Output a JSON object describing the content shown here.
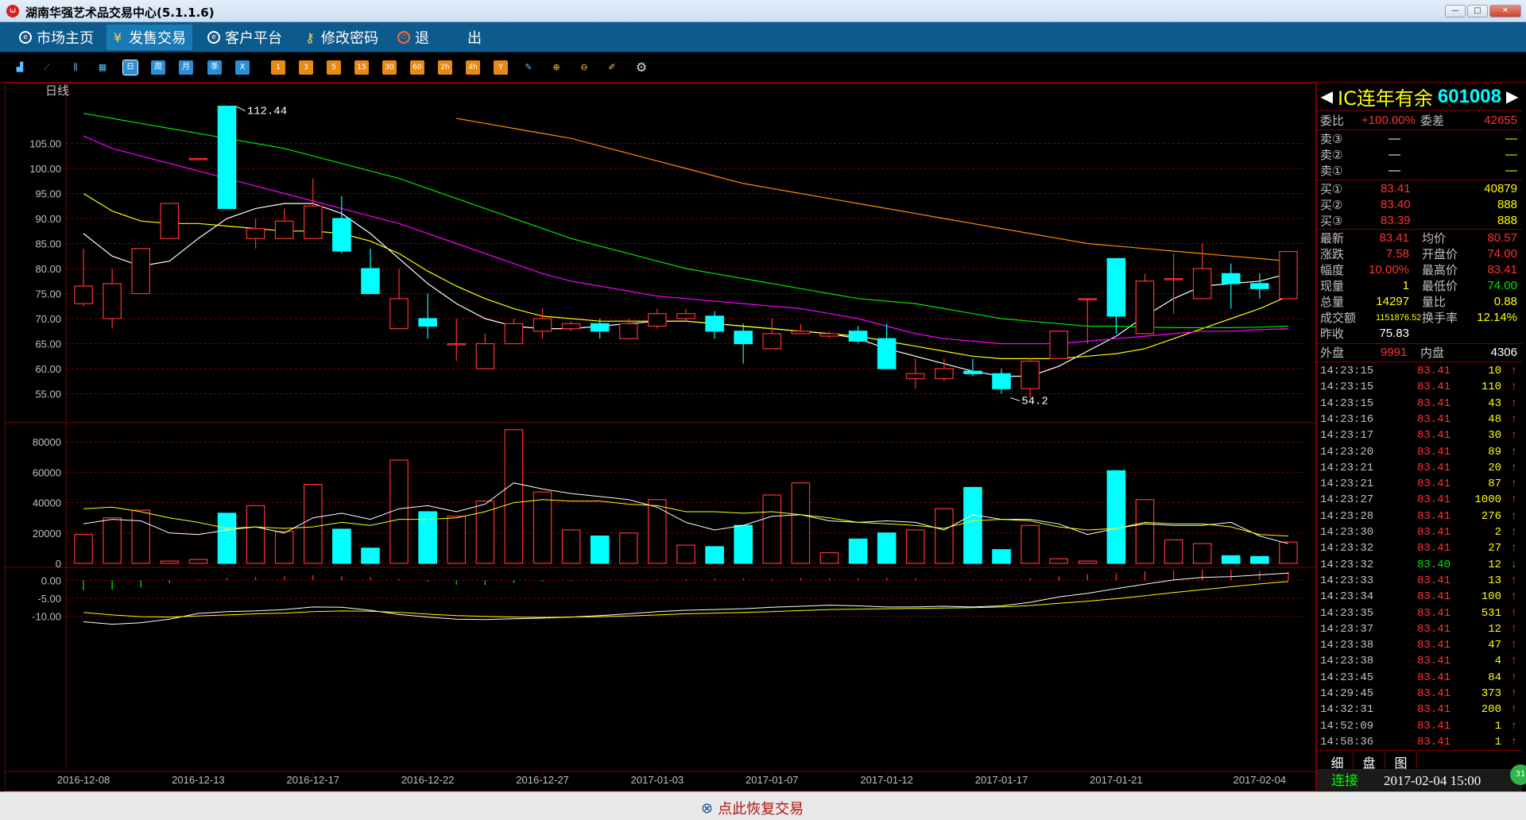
{
  "window": {
    "title": "湖南华强艺术品交易中心(5.1.1.6)",
    "logo_glyph": "ω",
    "btn_min": "—",
    "btn_max": "□",
    "btn_close": "✕"
  },
  "menu": [
    {
      "label": "市场主页",
      "icon": "globe-icon"
    },
    {
      "label": "发售交易",
      "icon": "yen-icon"
    },
    {
      "label": "客户平台",
      "icon": "globe-icon"
    },
    {
      "label": "修改密码",
      "icon": "key-icon"
    },
    {
      "label": "退",
      "icon": "power-icon"
    },
    {
      "label": "出",
      "icon": ""
    }
  ],
  "toolbar": {
    "period_buttons": [
      "日",
      "周",
      "月",
      "季",
      "X"
    ],
    "minute_buttons": [
      "1",
      "3",
      "5",
      "15",
      "30",
      "60",
      "2h",
      "4h",
      "Y"
    ],
    "selected": "日"
  },
  "chart_data": {
    "type": "candlestick",
    "period_label": "日线",
    "x_tick_labels": [
      "2016-12-08",
      "2016-12-13",
      "2016-12-17",
      "2016-12-22",
      "2016-12-27",
      "2017-01-03",
      "2017-01-07",
      "2017-01-12",
      "2017-01-17",
      "2017-01-21",
      "2017-02-04"
    ],
    "y_ticks_price": [
      "105.00",
      "100.00",
      "95.00",
      "90.00",
      "85.00",
      "80.00",
      "75.00",
      "70.00",
      "65.00",
      "60.00",
      "55.00"
    ],
    "y_ticks_volume": [
      "80000",
      "60000",
      "40000",
      "20000",
      "0"
    ],
    "y_ticks_macd": [
      "0.00",
      "-5.00",
      "-10.00"
    ],
    "annotations": {
      "high_label": "112.44",
      "low_label": "54.2"
    },
    "price_ylim": [
      50.0,
      113.5
    ],
    "volume_ylim": [
      0,
      90000
    ],
    "macd_ylim": [
      -12.5,
      2.5
    ],
    "candles": [
      {
        "o": 73,
        "h": 84,
        "l": 72.5,
        "c": 76.5
      },
      {
        "o": 70,
        "h": 80,
        "l": 68,
        "c": 77
      },
      {
        "o": 75,
        "h": 84,
        "l": 75,
        "c": 84
      },
      {
        "o": 86,
        "h": 92,
        "l": 86,
        "c": 93
      },
      {
        "o": 102,
        "h": 102,
        "l": 102,
        "c": 102
      },
      {
        "o": 112.44,
        "h": 112.44,
        "l": 92,
        "c": 92
      },
      {
        "o": 86,
        "h": 90,
        "l": 84,
        "c": 88
      },
      {
        "o": 86,
        "h": 92,
        "l": 86,
        "c": 89.5
      },
      {
        "o": 86,
        "h": 98,
        "l": 86,
        "c": 92.5
      },
      {
        "o": 90,
        "h": 94.5,
        "l": 83,
        "c": 83.5
      },
      {
        "o": 80,
        "h": 84,
        "l": 75,
        "c": 75
      },
      {
        "o": 68,
        "h": 80,
        "l": 68,
        "c": 74
      },
      {
        "o": 70,
        "h": 75,
        "l": 66,
        "c": 68.5
      },
      {
        "o": 65,
        "h": 70,
        "l": 61.5,
        "c": 65
      },
      {
        "o": 60,
        "h": 67,
        "l": 60,
        "c": 65
      },
      {
        "o": 65,
        "h": 70,
        "l": 65,
        "c": 69
      },
      {
        "o": 67.5,
        "h": 72,
        "l": 66,
        "c": 70
      },
      {
        "o": 68,
        "h": 69.5,
        "l": 67.5,
        "c": 69
      },
      {
        "o": 69,
        "h": 70,
        "l": 66,
        "c": 67.5
      },
      {
        "o": 66,
        "h": 70,
        "l": 66,
        "c": 69
      },
      {
        "o": 68.5,
        "h": 72,
        "l": 68,
        "c": 71
      },
      {
        "o": 70,
        "h": 72,
        "l": 69.5,
        "c": 71
      },
      {
        "o": 70.5,
        "h": 71.5,
        "l": 66,
        "c": 67.5
      },
      {
        "o": 67.5,
        "h": 69,
        "l": 61,
        "c": 65
      },
      {
        "o": 64,
        "h": 70,
        "l": 64,
        "c": 67
      },
      {
        "o": 67,
        "h": 69,
        "l": 67,
        "c": 67.5
      },
      {
        "o": 66.5,
        "h": 67.5,
        "l": 66,
        "c": 67
      },
      {
        "o": 67.5,
        "h": 68.5,
        "l": 65,
        "c": 65.5
      },
      {
        "o": 66,
        "h": 69,
        "l": 60,
        "c": 60
      },
      {
        "o": 58,
        "h": 62,
        "l": 56,
        "c": 59
      },
      {
        "o": 58,
        "h": 62,
        "l": 57.5,
        "c": 60
      },
      {
        "o": 59.5,
        "h": 62,
        "l": 58.5,
        "c": 59
      },
      {
        "o": 59,
        "h": 60,
        "l": 55,
        "c": 56
      },
      {
        "o": 56,
        "h": 62,
        "l": 54.2,
        "c": 61.5
      },
      {
        "o": 62,
        "h": 67.5,
        "l": 62,
        "c": 67.5
      },
      {
        "o": 74,
        "h": 74,
        "l": 65,
        "c": 74
      },
      {
        "o": 82,
        "h": 82,
        "l": 67,
        "c": 70.5
      },
      {
        "o": 67,
        "h": 79,
        "l": 67,
        "c": 77.5
      },
      {
        "o": 78,
        "h": 83,
        "l": 71,
        "c": 78
      },
      {
        "o": 74,
        "h": 85,
        "l": 74,
        "c": 80
      },
      {
        "o": 79,
        "h": 81,
        "l": 72,
        "c": 77
      },
      {
        "o": 77,
        "h": 79,
        "l": 74,
        "c": 76
      },
      {
        "o": 74,
        "h": 83.41,
        "l": 74,
        "c": 83.41
      }
    ],
    "ma_series": [
      {
        "color": "#ffffff",
        "values": [
          87.0,
          82.5,
          80.5,
          81.5,
          86.0,
          90.0,
          92.0,
          93.0,
          93.0,
          91.0,
          87.0,
          82.0,
          77.0,
          73.0,
          70.0,
          68.5,
          68.0,
          68.0,
          68.5,
          69.0,
          69.5,
          69.5,
          69.0,
          68.5,
          68.0,
          67.5,
          67.0,
          66.0,
          64.0,
          62.5,
          61.0,
          59.5,
          58.5,
          58.5,
          60.5,
          63.5,
          66.5,
          70.5,
          74.0,
          76.5,
          77.0,
          77.5,
          79.0
        ]
      },
      {
        "color": "#ffff00",
        "values": [
          95.0,
          91.5,
          89.5,
          89.0,
          89.0,
          88.5,
          88.0,
          87.5,
          87.5,
          87.0,
          85.5,
          83.0,
          79.5,
          76.5,
          74.0,
          72.0,
          70.5,
          70.0,
          69.5,
          69.5,
          69.5,
          69.5,
          69.0,
          68.5,
          68.0,
          67.5,
          67.0,
          66.5,
          65.5,
          64.5,
          63.5,
          62.5,
          62.0,
          62.0,
          62.0,
          62.5,
          63.0,
          64.0,
          66.0,
          68.0,
          70.0,
          72.0,
          74.5
        ]
      },
      {
        "color": "#ff00ff",
        "values": [
          106.5,
          104.0,
          102.5,
          101.0,
          99.5,
          98.0,
          96.5,
          95.0,
          93.5,
          92.0,
          90.5,
          89.0,
          87.0,
          85.0,
          83.0,
          81.0,
          79.0,
          77.5,
          76.5,
          75.5,
          74.5,
          74.0,
          73.5,
          73.0,
          72.5,
          72.0,
          71.0,
          70.0,
          68.5,
          67.0,
          66.0,
          65.5,
          65.0,
          65.0,
          65.0,
          65.5,
          66.0,
          66.5,
          67.0,
          67.5,
          67.5,
          67.8,
          68.0
        ]
      },
      {
        "color": "#00e600",
        "values": [
          111.0,
          110.0,
          109.0,
          108.0,
          107.0,
          106.0,
          105.0,
          104.0,
          102.5,
          101.0,
          99.5,
          98.0,
          96.0,
          94.0,
          92.0,
          90.0,
          88.0,
          86.0,
          84.5,
          83.0,
          81.5,
          80.0,
          79.0,
          78.0,
          77.0,
          76.0,
          75.0,
          74.0,
          73.5,
          73.0,
          72.0,
          71.0,
          70.0,
          69.5,
          69.0,
          68.5,
          68.5,
          68.3,
          68.2,
          68.2,
          68.2,
          68.3,
          68.5
        ]
      },
      {
        "color": "#ff8c00",
        "start_index": 13,
        "values": [
          110.0,
          109.0,
          108.0,
          107.0,
          106.0,
          104.5,
          103.0,
          101.5,
          100.0,
          98.5,
          97.0,
          96.0,
          95.0,
          94.0,
          93.0,
          92.0,
          91.0,
          90.0,
          89.0,
          88.0,
          87.0,
          86.0,
          85.0,
          84.5,
          84.0,
          83.5,
          83.0,
          82.5,
          82.0,
          81.5
        ]
      }
    ],
    "volume": [
      19000,
      30000,
      35000,
      1500,
      2500,
      33000,
      38000,
      21000,
      52000,
      22500,
      10000,
      68000,
      34000,
      31000,
      41000,
      88000,
      47000,
      22000,
      18000,
      20000,
      42000,
      12000,
      11000,
      25000,
      45000,
      53000,
      7000,
      16000,
      20000,
      22000,
      36000,
      50000,
      9000,
      25000,
      3000,
      1500,
      61000,
      42000,
      15500,
      13000,
      5000,
      4500,
      14000
    ],
    "volume_ma": [
      {
        "color": "#ffffff",
        "values": [
          26000,
          29000,
          28000,
          20000,
          19000,
          22000,
          24000,
          20000,
          30000,
          33000,
          29000,
          36000,
          38000,
          34000,
          39000,
          53000,
          49000,
          46000,
          44000,
          42000,
          37000,
          27000,
          22000,
          25000,
          31000,
          32000,
          28000,
          27000,
          28000,
          27000,
          22000,
          32000,
          29000,
          29000,
          26000,
          19000,
          23000,
          26000,
          25000,
          25000,
          27000,
          18000,
          13000
        ]
      },
      {
        "color": "#ffff00",
        "values": [
          36000,
          37000,
          34000,
          30000,
          27000,
          23000,
          24000,
          23000,
          24000,
          27000,
          25000,
          29000,
          29000,
          30000,
          34000,
          40000,
          42000,
          41000,
          41000,
          39000,
          38000,
          34000,
          34000,
          33000,
          34000,
          32000,
          30000,
          27000,
          26000,
          25000,
          23000,
          28000,
          29000,
          28000,
          24000,
          22000,
          23000,
          27000,
          26000,
          26000,
          24000,
          19000,
          18000
        ]
      }
    ],
    "macd_bars": [
      -2.8,
      -2.6,
      -2.0,
      -0.8,
      0.2,
      0.6,
      0.9,
      1.1,
      1.4,
      1.2,
      0.9,
      0.4,
      -0.4,
      -1.2,
      -1.3,
      -0.8,
      -0.4,
      -0.2,
      -0.1,
      0.1,
      0.2,
      0.4,
      0.5,
      0.5,
      0.4,
      0.6,
      0.5,
      0.6,
      0.7,
      0.5,
      0.2,
      0.1,
      0.3,
      0.6,
      1.1,
      1.7,
      2.0,
      2.5,
      2.7,
      3.0,
      2.9,
      2.6,
      2.4
    ],
    "macd_diff": [
      -11.5,
      -12.2,
      -11.8,
      -10.8,
      -9.2,
      -8.7,
      -8.5,
      -8.1,
      -7.4,
      -7.5,
      -8.3,
      -9.5,
      -10.2,
      -10.8,
      -10.9,
      -10.7,
      -10.5,
      -10.2,
      -9.8,
      -9.3,
      -8.7,
      -8.3,
      -8.1,
      -7.9,
      -7.5,
      -7.2,
      -6.9,
      -7.1,
      -7.4,
      -7.4,
      -7.2,
      -7.4,
      -7.1,
      -6.1,
      -4.6,
      -3.6,
      -2.3,
      -1.1,
      0.1,
      0.8,
      1.0,
      1.5,
      2.0
    ],
    "macd_dea": [
      -8.9,
      -9.6,
      -10.1,
      -10.2,
      -9.9,
      -9.6,
      -9.3,
      -9.1,
      -8.7,
      -8.5,
      -8.6,
      -8.9,
      -9.4,
      -9.8,
      -10.0,
      -10.2,
      -10.3,
      -10.2,
      -10.1,
      -9.9,
      -9.6,
      -9.3,
      -9.1,
      -8.9,
      -8.7,
      -8.4,
      -8.1,
      -8.0,
      -7.9,
      -7.8,
      -7.7,
      -7.6,
      -7.4,
      -7.0,
      -6.4,
      -5.8,
      -5.1,
      -4.3,
      -3.4,
      -2.6,
      -1.8,
      -1.0,
      -0.3
    ]
  },
  "quote": {
    "name": "IC连年有余",
    "code": "601008",
    "weibi_label": "委比",
    "weibi_value": "+100.00%",
    "weicha_label": "委差",
    "weicha_value": "42655",
    "asks": [
      {
        "label": "卖③",
        "price": "—",
        "vol": "—"
      },
      {
        "label": "卖②",
        "price": "—",
        "vol": "—"
      },
      {
        "label": "卖①",
        "price": "—",
        "vol": "—"
      }
    ],
    "bids": [
      {
        "label": "买①",
        "price": "83.41",
        "vol": "40879"
      },
      {
        "label": "买②",
        "price": "83.40",
        "vol": "888"
      },
      {
        "label": "买③",
        "price": "83.39",
        "vol": "888"
      }
    ],
    "stats": [
      {
        "l1": "最新",
        "v1": "83.41",
        "l2": "均价",
        "v2": "80.57"
      },
      {
        "l1": "涨跌",
        "v1": "7.58",
        "l2": "开盘价",
        "v2": "74.00"
      },
      {
        "l1": "幅度",
        "v1": "10.00%",
        "l2": "最高价",
        "v2": "83.41"
      },
      {
        "l1": "现量",
        "v1": "1",
        "l2": "最低价",
        "v2": "74.00"
      },
      {
        "l1": "总量",
        "v1": "14297",
        "l2": "量比",
        "v2": "0.88"
      },
      {
        "l1": "成交额",
        "v1": "1151876.52",
        "l2": "换手率",
        "v2": "12.14%"
      },
      {
        "l1": "昨收",
        "v1": "75.83",
        "l2": "",
        "v2": ""
      }
    ],
    "outer_label": "外盘",
    "outer_value": "9991",
    "inner_label": "内盘",
    "inner_value": "4306",
    "ticks": [
      {
        "t": "14:23:15",
        "p": "83.41",
        "v": "10",
        "d": "↑"
      },
      {
        "t": "14:23:15",
        "p": "83.41",
        "v": "110",
        "d": "↑"
      },
      {
        "t": "14:23:15",
        "p": "83.41",
        "v": "43",
        "d": "↑"
      },
      {
        "t": "14:23:16",
        "p": "83.41",
        "v": "48",
        "d": "↑"
      },
      {
        "t": "14:23:17",
        "p": "83.41",
        "v": "30",
        "d": "↑"
      },
      {
        "t": "14:23:20",
        "p": "83.41",
        "v": "89",
        "d": "↑"
      },
      {
        "t": "14:23:21",
        "p": "83.41",
        "v": "20",
        "d": "↑"
      },
      {
        "t": "14:23:21",
        "p": "83.41",
        "v": "87",
        "d": "↑"
      },
      {
        "t": "14:23:27",
        "p": "83.41",
        "v": "1000",
        "d": "↑"
      },
      {
        "t": "14:23:28",
        "p": "83.41",
        "v": "276",
        "d": "↑"
      },
      {
        "t": "14:23:30",
        "p": "83.41",
        "v": "2",
        "d": "↑"
      },
      {
        "t": "14:23:32",
        "p": "83.41",
        "v": "27",
        "d": "↑"
      },
      {
        "t": "14:23:32",
        "p": "83.40",
        "v": "12",
        "d": "↓"
      },
      {
        "t": "14:23:33",
        "p": "83.41",
        "v": "13",
        "d": "↑"
      },
      {
        "t": "14:23:34",
        "p": "83.41",
        "v": "100",
        "d": "↑"
      },
      {
        "t": "14:23:35",
        "p": "83.41",
        "v": "531",
        "d": "↑"
      },
      {
        "t": "14:23:37",
        "p": "83.41",
        "v": "12",
        "d": "↑"
      },
      {
        "t": "14:23:38",
        "p": "83.41",
        "v": "47",
        "d": "↑"
      },
      {
        "t": "14:23:38",
        "p": "83.41",
        "v": "4",
        "d": "↑"
      },
      {
        "t": "14:23:45",
        "p": "83.41",
        "v": "84",
        "d": "↑"
      },
      {
        "t": "14:29:45",
        "p": "83.41",
        "v": "373",
        "d": "↑"
      },
      {
        "t": "14:32:31",
        "p": "83.41",
        "v": "200",
        "d": "↑"
      },
      {
        "t": "14:52:09",
        "p": "83.41",
        "v": "1",
        "d": "↑"
      },
      {
        "t": "14:58:36",
        "p": "83.41",
        "v": "1",
        "d": "↑"
      }
    ]
  },
  "side_tabs": [
    "细",
    "盘",
    "图"
  ],
  "connection": {
    "status": "连接",
    "time": "2017-02-04 15:00",
    "badge": "31"
  },
  "footer": {
    "restore_label": "点此恢复交易"
  },
  "colors": {
    "up": "#ff3232",
    "down": "#00ffff",
    "grid": "#800000",
    "axis_text": "#c0c0c0"
  }
}
